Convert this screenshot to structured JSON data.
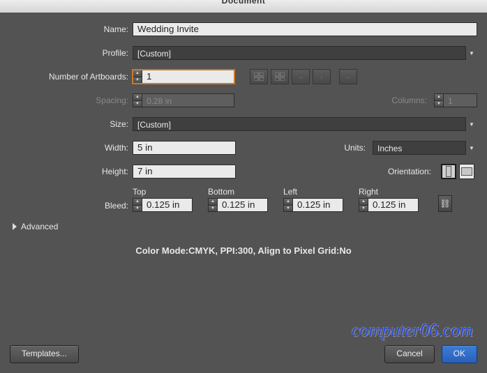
{
  "title_partial": "Document",
  "labels": {
    "name": "Name:",
    "profile": "Profile:",
    "num_artboards": "Number of Artboards:",
    "spacing": "Spacing:",
    "columns": "Columns:",
    "size": "Size:",
    "width": "Width:",
    "height": "Height:",
    "units": "Units:",
    "orientation": "Orientation:",
    "bleed": "Bleed:",
    "top": "Top",
    "bottom": "Bottom",
    "left": "Left",
    "right": "Right",
    "advanced": "Advanced"
  },
  "values": {
    "name": "Wedding Invite",
    "profile": "[Custom]",
    "num_artboards": "1",
    "spacing": "0.28 in",
    "columns": "1",
    "size": "[Custom]",
    "width": "5 in",
    "height": "7 in",
    "units": "Inches",
    "bleed": {
      "top": "0.125 in",
      "bottom": "0.125 in",
      "left": "0.125 in",
      "right": "0.125 in"
    }
  },
  "summary": "Color Mode:CMYK, PPI:300, Align to Pixel Grid:No",
  "buttons": {
    "templates": "Templates...",
    "cancel": "Cancel",
    "ok": "OK"
  },
  "watermark": "computer06.com"
}
